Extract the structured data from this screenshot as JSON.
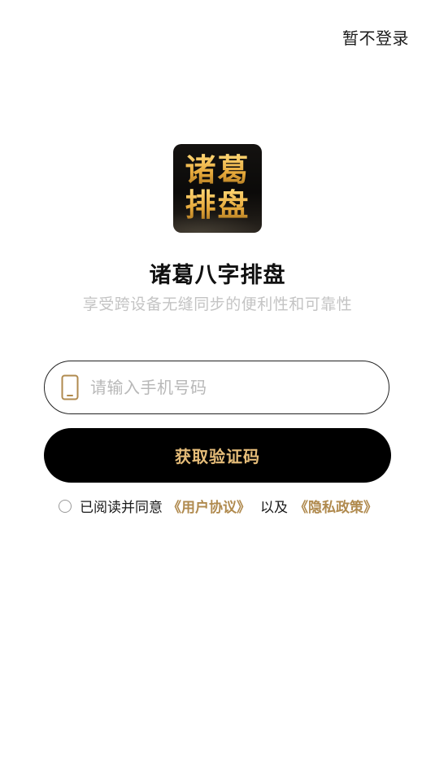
{
  "header": {
    "skip_login_label": "暂不登录"
  },
  "logo": {
    "line1": "诸葛",
    "line2": "排盘"
  },
  "app": {
    "title": "诸葛八字排盘",
    "subtitle": "享受跨设备无缝同步的便利性和可靠性"
  },
  "phone_field": {
    "icon": "mobile-phone-icon",
    "placeholder": "请输入手机号码",
    "value": ""
  },
  "code_button": {
    "label": "获取验证码"
  },
  "agreement": {
    "checked": false,
    "prefix": "已阅读并同意",
    "user_agreement_link": "《用户协议》",
    "conjunction": "以及",
    "privacy_policy_link": "《隐私政策》"
  },
  "colors": {
    "accent_gold": "#b08a4e",
    "button_bg": "#000000",
    "button_text": "#e6bd79",
    "subtitle_gray": "#c4c4c4"
  }
}
